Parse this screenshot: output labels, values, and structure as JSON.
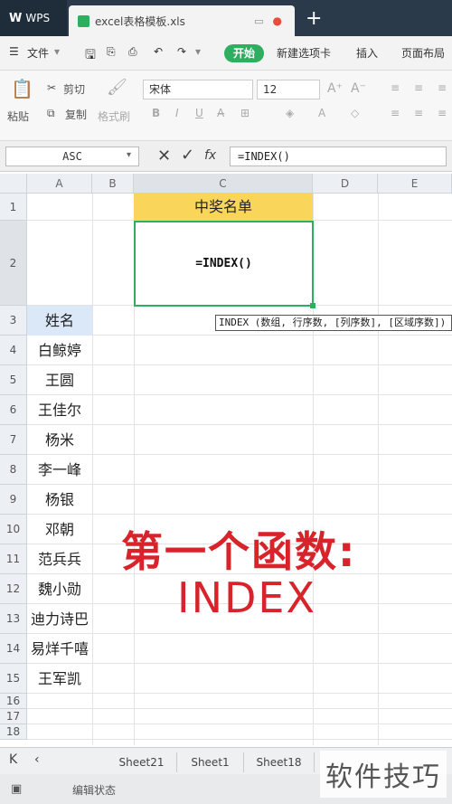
{
  "titlebar": {
    "app_name": "WPS",
    "doc_tab": "excel表格模板.xls"
  },
  "menubar": {
    "file": "文件",
    "start": "开始",
    "new_tab": "新建选项卡",
    "insert": "插入",
    "page_layout": "页面布局"
  },
  "ribbon": {
    "paste": "粘贴",
    "cut": "剪切",
    "copy": "复制",
    "format_painter": "格式刷",
    "font_name": "宋体",
    "font_size": "12"
  },
  "formula_bar": {
    "name_box": "ASC",
    "fx": "fx",
    "formula": "=INDEX()"
  },
  "columns": [
    "A",
    "B",
    "C",
    "D",
    "E"
  ],
  "rows": [
    "1",
    "2",
    "3",
    "4",
    "5",
    "6",
    "7",
    "8",
    "9",
    "10",
    "11",
    "12",
    "13",
    "14",
    "15",
    "16",
    "17",
    "18"
  ],
  "cells": {
    "c1": "中奖名单",
    "c2": "=INDEX()",
    "a3": "姓名",
    "names": [
      "白鲸婷",
      "王圆",
      "王佳尔",
      "杨米",
      "李一峰",
      "杨银",
      "邓朝",
      "范兵兵",
      "魏小勋",
      "迪力诗巴",
      "易烊千嘻",
      "王军凯"
    ]
  },
  "tooltip": "INDEX (数组, 行序数, [列序数], [区域序数])",
  "overlay": {
    "line1": "第一个函数:",
    "line2": "INDEX"
  },
  "sheets": [
    "Sheet21",
    "Sheet1",
    "Sheet18"
  ],
  "status": "编辑状态",
  "watermark": "软件技巧",
  "colors": {
    "accent_green": "#2eae5f",
    "header_yellow": "#f9d55a",
    "name_header_blue": "#dbe8f8",
    "overlay_red": "#d8232a"
  }
}
